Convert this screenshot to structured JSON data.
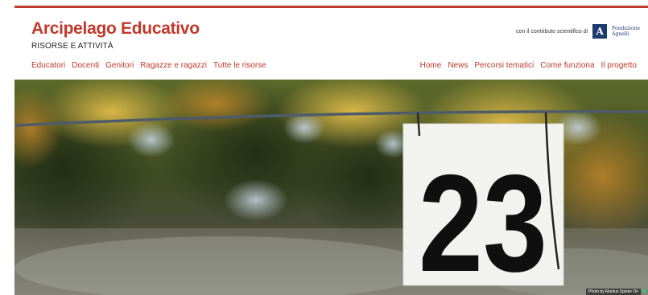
{
  "header": {
    "title": "Arcipelago Educativo",
    "subtitle": "RISORSE E ATTIVITÀ",
    "sponsor_text": "con il contributo scientifico di",
    "sponsor_name_line1": "Fondazione",
    "sponsor_name_line2": "Agnelli",
    "accent_color": "#c0392b"
  },
  "nav_left": {
    "items": [
      {
        "label": "Educatori"
      },
      {
        "label": "Docenti"
      },
      {
        "label": "Genitori"
      },
      {
        "label": "Ragazze e ragazzi"
      },
      {
        "label": "Tutte le risorse"
      }
    ]
  },
  "nav_right": {
    "items": [
      {
        "label": "Home"
      },
      {
        "label": "News"
      },
      {
        "label": "Percorsi tematici"
      },
      {
        "label": "Come funziona"
      },
      {
        "label": "Il progetto"
      }
    ]
  },
  "hero": {
    "sign_number": "23",
    "photo_credit": "Photo by Markus Spiske On"
  }
}
